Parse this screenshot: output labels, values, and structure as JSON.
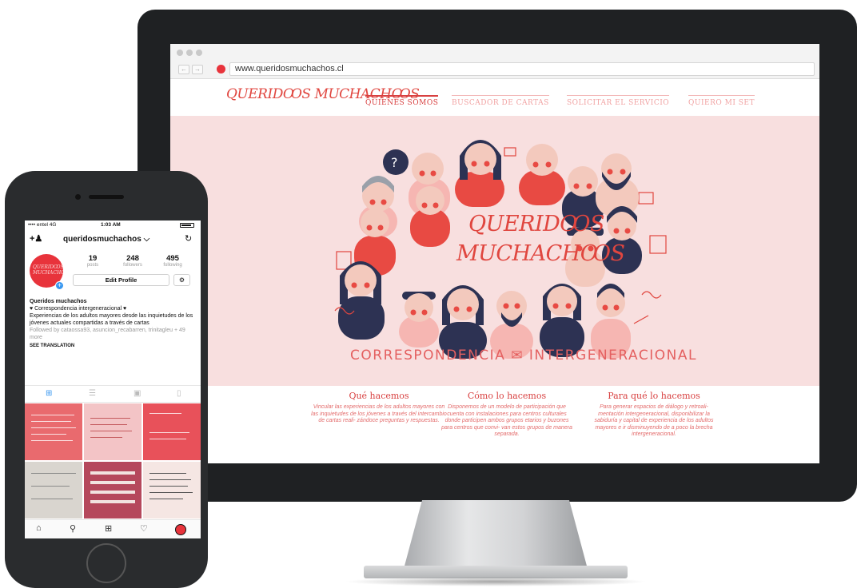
{
  "browser": {
    "url": "www.queridosmuchachos.cl"
  },
  "site": {
    "logo": "QUERIDꝎS MUCHACHꝎS",
    "nav": [
      {
        "label": "QUIENES SOMOS",
        "active": true
      },
      {
        "label": "BUSCADOR DE CARTAS",
        "active": false
      },
      {
        "label": "SOLICITAR EL SERVICIO",
        "active": false
      },
      {
        "label": "QUIERO MI SET",
        "active": false
      }
    ],
    "hero": {
      "title_line1": "QUERIDꝎS",
      "title_line2": "MUCHACHꝎS",
      "tagline": "CORRESPONDENCIA ✉ INTERGENERACIONAL"
    },
    "columns": [
      {
        "title": "Qué hacemos",
        "text": "Vincular las experiencias de los adultos mayores con las inquietudes de los jóvenes a través del intercambio de cartas reali- zándoce preguntas y respuestas."
      },
      {
        "title": "Cómo lo hacemos",
        "text": "Disponemos de un modelo de participación que cuenta con instalaciones para centros culturales donde participen ambos grupos etarios y buzones para centros que convi- van estos grupos de manera separada."
      },
      {
        "title": "Para qué lo hacemos",
        "text": "Para generar espacios de diálogo y retroali- mentación intergeneracional, disponibilizar la sabiduría y capital de experiencia de los adultos mayores e ir disminuyendo de a poco la brecha intergeneracional."
      }
    ],
    "colors": {
      "accent": "#e0463f",
      "hero_bg": "#f8dfdf",
      "navy": "#2d3253"
    }
  },
  "phone": {
    "status": {
      "carrier": "•••• entel  4G",
      "time": "1:03 AM"
    },
    "header": {
      "username": "queridosmuchachos ⌵"
    },
    "avatar_text": "QUERIDꝎS MUCHACHꝎS",
    "stats": [
      {
        "num": "19",
        "label": "posts"
      },
      {
        "num": "248",
        "label": "followers"
      },
      {
        "num": "495",
        "label": "following"
      }
    ],
    "edit_profile": "Edit Profile",
    "bio": {
      "name": "Queridos muchachos",
      "line1": "♥ Correspondencia intergeneracional ♥",
      "line2": "Experiencias de los adultos mayores desde las inquietudes de los jóvenes actuales compartidas a través de cartas",
      "followed": "Followed by cataossa93, asuncion_recabarren, trinitagleu + 49 more",
      "see_translation": "SEE TRANSLATION"
    },
    "icons": {
      "add_user": "add-user-icon",
      "history": "history-icon",
      "grid": "grid-icon",
      "list": "list-icon",
      "tagged": "tagged-icon",
      "saved": "bookmark-icon",
      "home": "home-icon",
      "search": "search-icon",
      "new_post": "plus-square-icon",
      "activity": "heart-icon",
      "profile": "profile-icon"
    }
  }
}
